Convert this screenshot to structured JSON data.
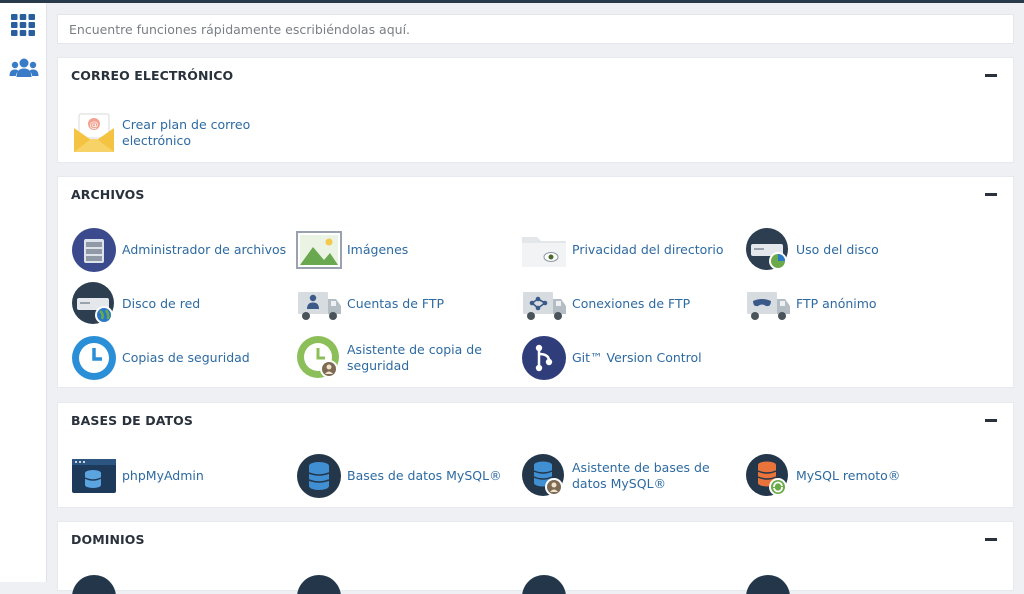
{
  "search": {
    "placeholder": "Encuentre funciones rápidamente escribiéndolas aquí."
  },
  "sidebar": {
    "icons": [
      "apps-grid-icon",
      "users-icon"
    ]
  },
  "sections": {
    "email": {
      "title": "CORREO ELECTRÓNICO",
      "items": [
        {
          "label": "Crear plan de correo electrónico",
          "icon": "mail-envelope-icon"
        }
      ]
    },
    "files": {
      "title": "ARCHIVOS",
      "items": [
        {
          "label": "Administrador de archivos",
          "icon": "file-manager-icon"
        },
        {
          "label": "Imágenes",
          "icon": "images-icon"
        },
        {
          "label": "Privacidad del directorio",
          "icon": "folder-privacy-icon"
        },
        {
          "label": "Uso del disco",
          "icon": "disk-usage-icon"
        },
        {
          "label": "Disco de red",
          "icon": "network-disk-icon"
        },
        {
          "label": "Cuentas de FTP",
          "icon": "ftp-accounts-icon"
        },
        {
          "label": "Conexiones de FTP",
          "icon": "ftp-connections-icon"
        },
        {
          "label": "FTP anónimo",
          "icon": "anonymous-ftp-icon"
        },
        {
          "label": "Copias de seguridad",
          "icon": "backup-icon"
        },
        {
          "label": "Asistente de copia de seguridad",
          "icon": "backup-wizard-icon"
        },
        {
          "label": "Git™ Version Control",
          "icon": "git-icon"
        }
      ]
    },
    "databases": {
      "title": "BASES DE DATOS",
      "items": [
        {
          "label": "phpMyAdmin",
          "icon": "phpmyadmin-icon"
        },
        {
          "label": "Bases de datos MySQL®",
          "icon": "mysql-databases-icon"
        },
        {
          "label": "Asistente de bases de datos MySQL®",
          "icon": "mysql-wizard-icon"
        },
        {
          "label": "MySQL remoto®",
          "icon": "remote-mysql-icon"
        }
      ]
    },
    "domains": {
      "title": "DOMINIOS"
    }
  },
  "colors": {
    "link": "#2d6aa1",
    "title": "#29323c",
    "navy": "#293a4a",
    "icon_blue": "#2a78c9"
  }
}
